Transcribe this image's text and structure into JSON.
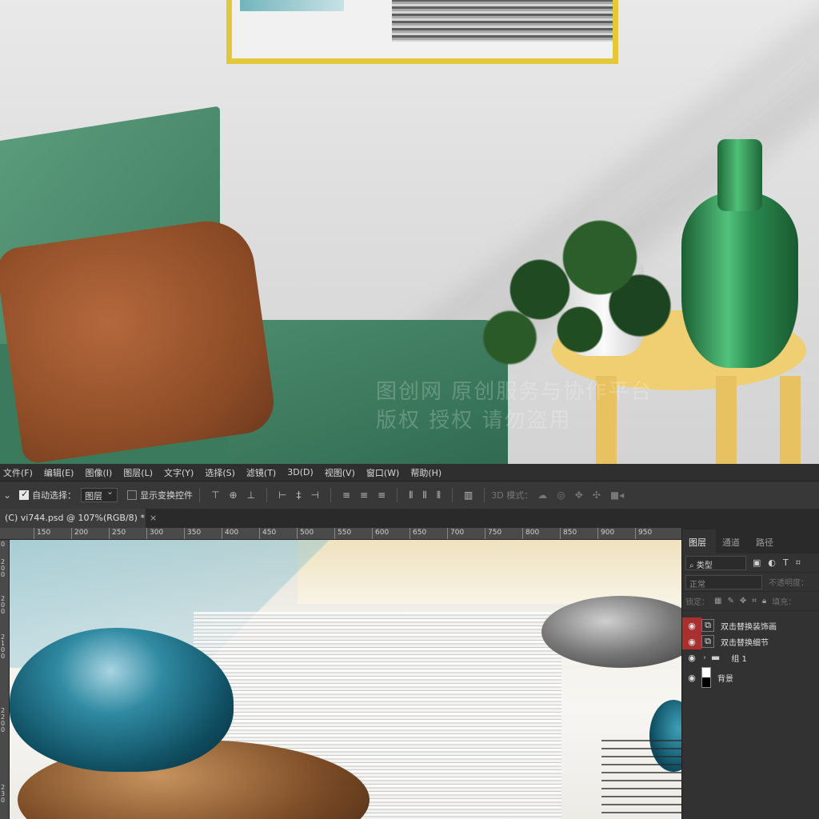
{
  "watermark": {
    "line1": "图创网 原创服务与协作平台",
    "line2": "版权 授权 请勿盗用"
  },
  "menubar": {
    "items": [
      "文件(F)",
      "编辑(E)",
      "图像(I)",
      "图层(L)",
      "文字(Y)",
      "选择(S)",
      "滤镜(T)",
      "3D(D)",
      "视图(V)",
      "窗口(W)",
      "帮助(H)"
    ]
  },
  "options": {
    "auto_select_label": "自动选择：",
    "auto_select_checked": true,
    "auto_select_target": "图层",
    "show_transform_label": "显示变换控件",
    "mode_3d_label": "3D 模式："
  },
  "document": {
    "tab_title": "(C) vi744.psd @ 107%(RGB/8) *",
    "close_glyph": "×"
  },
  "ruler": {
    "h_labels": [
      "150",
      "200",
      "250",
      "300",
      "350",
      "400",
      "450",
      "500",
      "550",
      "600",
      "650",
      "700",
      "750",
      "800",
      "850",
      "900",
      "950"
    ],
    "v_labels": [
      "0",
      "2",
      "0",
      "0",
      "2",
      "0",
      "0",
      "2",
      "1",
      "0",
      "0",
      "2",
      "2",
      "0",
      "0",
      "2",
      "3",
      "0"
    ]
  },
  "layers_panel": {
    "tabs": [
      "图层",
      "通道",
      "路径"
    ],
    "active_tab": "图层",
    "filter_label": "类型",
    "blend_mode": "正常",
    "opacity_label": "不透明度：",
    "lock_label": "锁定：",
    "fill_label": "填充：",
    "layers": [
      {
        "name": "双击替换装饰画",
        "visible": true,
        "selected": true
      },
      {
        "name": "双击替换细节",
        "visible": true,
        "selected": true
      },
      {
        "name": "组 1",
        "visible": true,
        "group": true
      },
      {
        "name": "背景",
        "visible": true,
        "background": true
      }
    ]
  }
}
